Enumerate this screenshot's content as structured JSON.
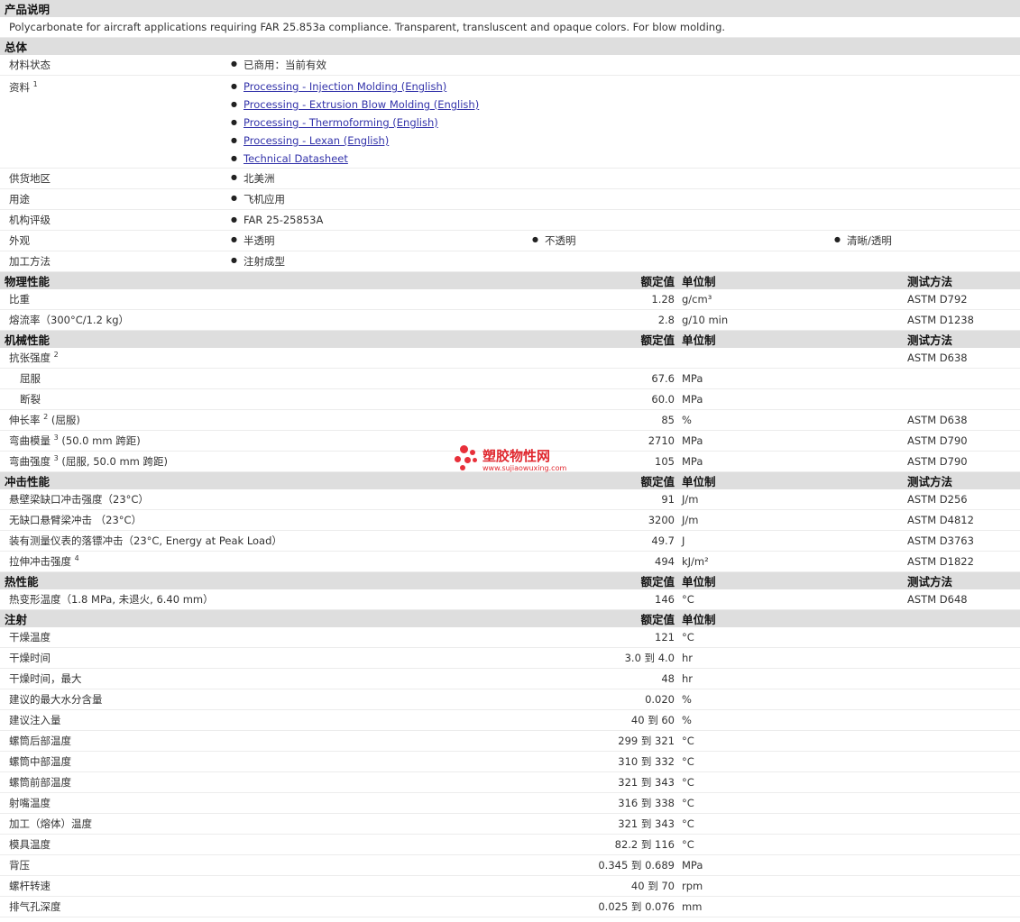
{
  "sections": {
    "product": "产品说明",
    "general": "总体",
    "physical": "物理性能",
    "mechanical": "机械性能",
    "impact": "冲击性能",
    "thermal": "热性能",
    "injection": "注射"
  },
  "columns": {
    "value": "额定值",
    "unit": "单位制",
    "method": "测试方法"
  },
  "description": "Polycarbonate for aircraft applications requiring FAR 25.853a compliance. Transparent, transluscent and opaque colors. For blow molding.",
  "general": {
    "status_label": "材料状态",
    "status": "已商用：当前有效",
    "docs_label": "资料",
    "docs_sup": "1",
    "docs": [
      "Processing - Injection Molding (English)",
      "Processing - Extrusion Blow Molding (English)",
      "Processing - Thermoforming (English)",
      "Processing - Lexan (English)",
      "Technical Datasheet"
    ],
    "region_label": "供货地区",
    "region": "北美洲",
    "use_label": "用途",
    "use": "飞机应用",
    "rating_label": "机构评级",
    "rating": "FAR 25-25853A",
    "appearance_label": "外观",
    "appearance": [
      "半透明",
      "不透明",
      "清晰/透明"
    ],
    "process_label": "加工方法",
    "process": "注射成型"
  },
  "physical": [
    {
      "label": "比重",
      "value": "1.28",
      "unit": "g/cm³",
      "method": "ASTM D792"
    },
    {
      "label": "熔流率（300°C/1.2 kg）",
      "value": "2.8",
      "unit": "g/10 min",
      "method": "ASTM D1238"
    }
  ],
  "mechanical": [
    {
      "label": "抗张强度",
      "sup": "2",
      "value": "",
      "unit": "",
      "method": "ASTM D638"
    },
    {
      "label": "屈服",
      "indent": true,
      "value": "67.6",
      "unit": "MPa",
      "method": ""
    },
    {
      "label": "断裂",
      "indent": true,
      "value": "60.0",
      "unit": "MPa",
      "method": ""
    },
    {
      "label": "伸长率",
      "sup": "2",
      "suffix": "(屈服)",
      "value": "85",
      "unit": "%",
      "method": "ASTM D638"
    },
    {
      "label": "弯曲模量",
      "sup": "3",
      "suffix": "(50.0 mm 跨距)",
      "value": "2710",
      "unit": "MPa",
      "method": "ASTM D790"
    },
    {
      "label": "弯曲强度",
      "sup": "3",
      "suffix": "(屈服, 50.0 mm 跨距)",
      "value": "105",
      "unit": "MPa",
      "method": "ASTM D790"
    }
  ],
  "impact": [
    {
      "label": "悬壁梁缺口冲击强度（23°C）",
      "value": "91",
      "unit": "J/m",
      "method": "ASTM D256"
    },
    {
      "label": "无缺口悬臂梁冲击 （23°C）",
      "value": "3200",
      "unit": "J/m",
      "method": "ASTM D4812"
    },
    {
      "label": "装有测量仪表的落镖冲击（23°C, Energy at Peak Load）",
      "value": "49.7",
      "unit": "J",
      "method": "ASTM D3763"
    },
    {
      "label": "拉伸冲击强度",
      "sup": "4",
      "value": "494",
      "unit": "kJ/m²",
      "method": "ASTM D1822"
    }
  ],
  "thermal": [
    {
      "label": "热变形温度（1.8 MPa, 未退火, 6.40 mm）",
      "value": "146",
      "unit": "°C",
      "method": "ASTM D648"
    }
  ],
  "injection": [
    {
      "label": "干燥温度",
      "value": "121",
      "unit": "°C"
    },
    {
      "label": "干燥时间",
      "value": "3.0 到  4.0",
      "unit": "hr"
    },
    {
      "label": "干燥时间，最大",
      "value": "48",
      "unit": "hr"
    },
    {
      "label": "建议的最大水分含量",
      "value": "0.020",
      "unit": "%"
    },
    {
      "label": "建议注入量",
      "value": "40 到  60",
      "unit": "%"
    },
    {
      "label": "螺筒后部温度",
      "value": "299 到  321",
      "unit": "°C"
    },
    {
      "label": "螺筒中部温度",
      "value": "310 到  332",
      "unit": "°C"
    },
    {
      "label": "螺筒前部温度",
      "value": "321 到  343",
      "unit": "°C"
    },
    {
      "label": "射嘴温度",
      "value": "316 到  338",
      "unit": "°C"
    },
    {
      "label": "加工（熔体）温度",
      "value": "321 到  343",
      "unit": "°C"
    },
    {
      "label": "模具温度",
      "value": "82.2 到  116",
      "unit": "°C"
    },
    {
      "label": "背压",
      "value": "0.345 到  0.689",
      "unit": "MPa"
    },
    {
      "label": "螺杆转速",
      "value": "40 到  70",
      "unit": "rpm"
    },
    {
      "label": "排气孔深度",
      "value": "0.025 到  0.076",
      "unit": "mm"
    }
  ],
  "watermark": {
    "cn": "塑胶物性网",
    "en": "www.sujiaowuxing.com"
  }
}
